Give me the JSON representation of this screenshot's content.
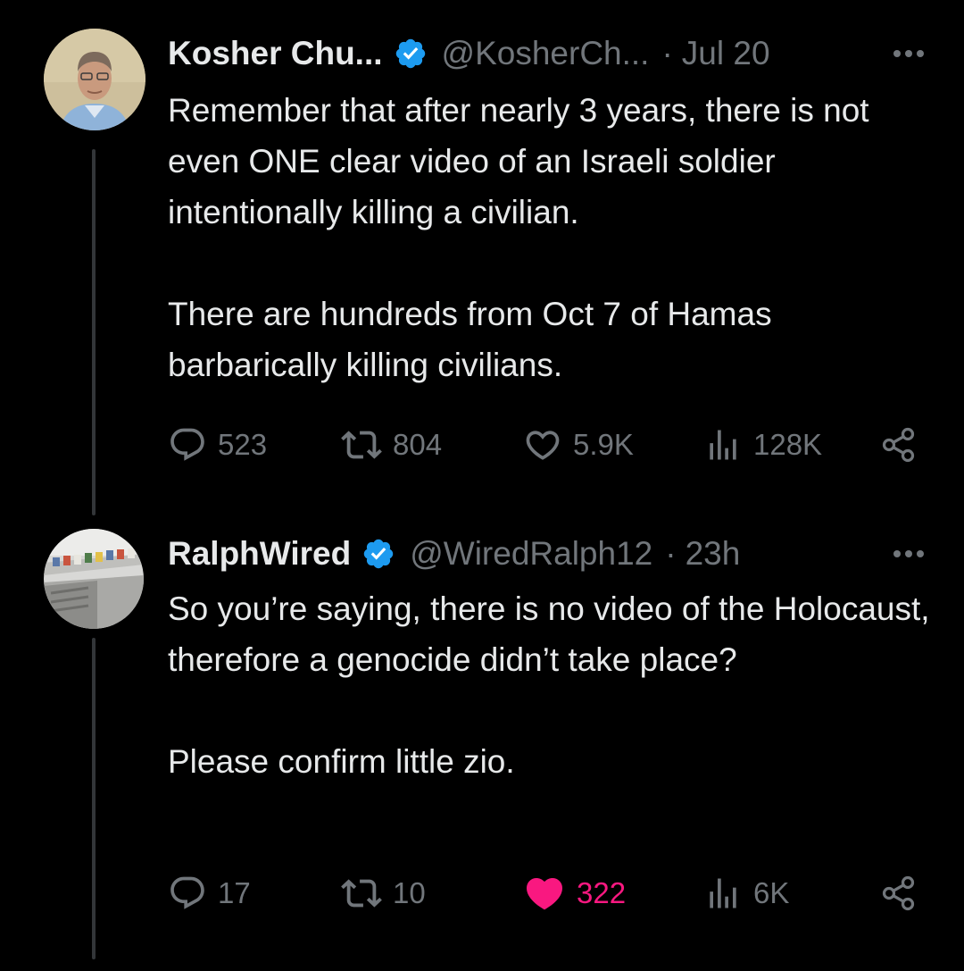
{
  "tweets": [
    {
      "display_name": "Kosher Chu...",
      "handle": "@KosherCh...",
      "separator": "·",
      "time": "Jul 20",
      "text_paragraphs": [
        "Remember that after nearly 3 years, there is not even ONE clear video of an Israeli soldier intentionally killing a civilian.",
        "There are hundreds from Oct 7 of Hamas barbarically killing civilians."
      ],
      "replies": "523",
      "reposts": "804",
      "likes": "5.9K",
      "views": "128K",
      "liked": false
    },
    {
      "display_name": "RalphWired",
      "handle": "@WiredRalph12",
      "separator": "·",
      "time": "23h",
      "text_paragraphs": [
        "So you’re saying, there is no video of the Holocaust, therefore a genocide didn’t take place?",
        "Please confirm little zio."
      ],
      "replies": "17",
      "reposts": "10",
      "likes": "322",
      "views": "6K",
      "liked": true
    }
  ],
  "colors": {
    "background": "#000000",
    "text": "#e7e9ea",
    "muted": "#71767b",
    "verified": "#1d9bf0",
    "like_active": "#f91880",
    "thread_line": "#333639"
  },
  "icons": [
    "verified-badge-icon",
    "more-icon",
    "reply-icon",
    "repost-icon",
    "like-icon",
    "views-icon",
    "share-icon"
  ]
}
